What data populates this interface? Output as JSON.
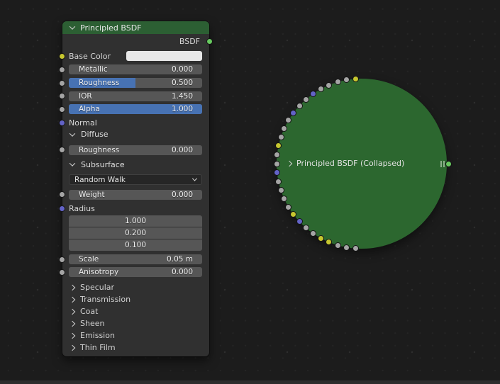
{
  "colors": {
    "header_green": "#2c5f33",
    "collapsed_green": "#2c672f",
    "slider_blue": "#4772b3",
    "socket_gray": "#a5a5a5",
    "socket_yellow": "#c7c72f",
    "socket_vector": "#6363c7",
    "socket_shader": "#67c95f"
  },
  "node": {
    "title": "Principled BSDF",
    "output_label": "BSDF",
    "base_color": {
      "label": "Base Color"
    },
    "metallic": {
      "label": "Metallic",
      "value": "0.000",
      "fill_pct": 0
    },
    "roughness": {
      "label": "Roughness",
      "value": "0.500",
      "fill_pct": 50
    },
    "ior": {
      "label": "IOR",
      "value": "1.450",
      "fill_pct": 0
    },
    "alpha": {
      "label": "Alpha",
      "value": "1.000",
      "fill_pct": 100
    },
    "normal": {
      "label": "Normal"
    },
    "diffuse": {
      "label": "Diffuse",
      "roughness": {
        "label": "Roughness",
        "value": "0.000",
        "fill_pct": 0
      }
    },
    "subsurface": {
      "label": "Subsurface",
      "method": "Random Walk",
      "weight": {
        "label": "Weight",
        "value": "0.000",
        "fill_pct": 0
      },
      "radius": {
        "label": "Radius",
        "values": [
          "1.000",
          "0.200",
          "0.100"
        ]
      },
      "scale": {
        "label": "Scale",
        "value": "0.05 m",
        "fill_pct": 0
      },
      "anisotropy": {
        "label": "Anisotropy",
        "value": "0.000",
        "fill_pct": 0
      }
    },
    "collapsed_panels": [
      "Specular",
      "Transmission",
      "Coat",
      "Sheen",
      "Emission",
      "Thin Film"
    ]
  },
  "collapsed_node": {
    "label": "Principled BSDF (Collapsed)",
    "output_socket": "shader",
    "input_sockets": [
      "yellow",
      "gray",
      "gray",
      "gray",
      "gray",
      "vector",
      "gray",
      "gray",
      "vector",
      "gray",
      "gray",
      "gray",
      "yellow",
      "gray",
      "gray",
      "vector",
      "gray",
      "gray",
      "gray",
      "gray",
      "yellow",
      "vector",
      "gray",
      "gray",
      "yellow",
      "yellow",
      "gray",
      "gray",
      "gray"
    ]
  }
}
